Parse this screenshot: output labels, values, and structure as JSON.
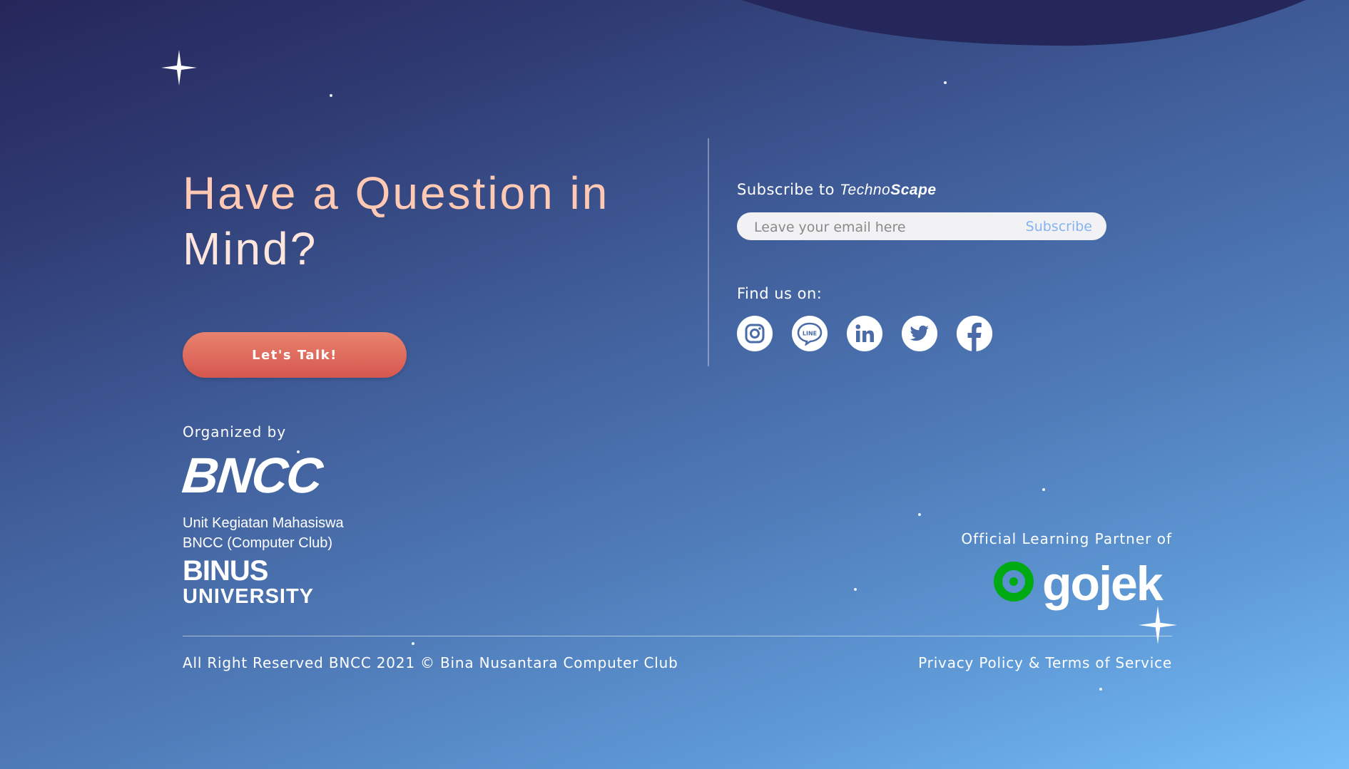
{
  "hero": {
    "headline_line1": "Have a Question in",
    "headline_line2": "Mind?",
    "cta_label": "Let's Talk!"
  },
  "organizer": {
    "label": "Organized by",
    "logo_text": "BNCC",
    "unit_line1": "Unit Kegiatan Mahasiswa",
    "unit_line2": "BNCC (Computer Club)",
    "university_line1": "BINUS",
    "university_line2": "UNIVERSITY"
  },
  "subscribe": {
    "title_prefix": "Subscribe to ",
    "brand_part1": "Techno",
    "brand_part2": "Scape",
    "placeholder": "Leave your email here",
    "button_label": "Subscribe"
  },
  "social": {
    "label": "Find us on:",
    "items": [
      {
        "name": "instagram-icon"
      },
      {
        "name": "line-icon",
        "text": "LINE"
      },
      {
        "name": "linkedin-icon"
      },
      {
        "name": "twitter-icon"
      },
      {
        "name": "facebook-icon"
      }
    ]
  },
  "partner": {
    "label": "Official Learning Partner of",
    "logo_text": "gojek"
  },
  "footer": {
    "copyright": "All Right Reserved BNCC 2021 © Bina Nusantara Computer Club",
    "policy_link": "Privacy Policy & Terms of Service"
  },
  "colors": {
    "headline_accent": "#ffc9b3",
    "cta_top": "#e8826e",
    "cta_bottom": "#d6574e",
    "social_icon": "#4a6aa8",
    "gojek_green": "#00aa13",
    "subscribe_link": "#86b3f0"
  }
}
